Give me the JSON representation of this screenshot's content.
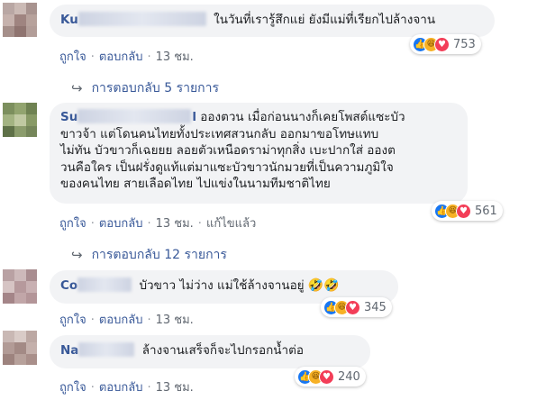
{
  "comments": [
    {
      "name": "Ku",
      "text": "ในวันที่เรารู้สึกแย่ ยังมีแม่ที่เรียกไปล้างจาน",
      "like": "ถูกใจ",
      "reply": "ตอบกลับ",
      "time": "13 ชม.",
      "reaction_count": "753",
      "reactions": [
        "like-icon",
        "haha-icon",
        "love-icon"
      ],
      "replies_label": "การตอบกลับ 5 รายการ"
    },
    {
      "name": "Su",
      "name_tail": "l",
      "text": "อองตวน เมื่อก่อนนางก็เคยโพสต์แซะบัวขาวจ้า แต่โดนคนไทยทั้งประเทศสวนกลับ ออกมาขอโทษแทบไม่ทัน บัวขาวก็เฉยยย ลอยตัวเหนือดราม่าทุกสิ่ง เบะปากใส่ อองตวนคือใคร เป็นฝรั่งดูแท้แต่มาแซะบัวขาวนักมวยที่เป็นความภูมิใจของคนไทย สายเลือดไทย ไปแข่งในนามทีมชาติไทย",
      "lines": [
        "อองตวน เมื่อก่อนนางก็เคยโพสต์แซะบัว",
        "ขาวจ้า แต่โดนคนไทยทั้งประเทศสวนกลับ ออกมาขอโทษแทบ",
        "ไม่ทัน บัวขาวก็เฉยยย ลอยตัวเหนือดราม่าทุกสิ่ง เบะปากใส่ อองต",
        "วนคือใคร เป็นฝรั่งดูแท้แต่มาแซะบัวขาวนักมวยที่เป็นความภูมิใจ",
        "ของคนไทย สายเลือดไทย ไปแข่งในนามทีมชาติไทย"
      ],
      "like": "ถูกใจ",
      "reply": "ตอบกลับ",
      "time": "13 ชม.",
      "edited": "แก้ไขแล้ว",
      "reaction_count": "561",
      "reactions": [
        "like-icon",
        "haha-icon",
        "love-icon"
      ],
      "replies_label": "การตอบกลับ 12 รายการ"
    },
    {
      "name": "Co",
      "text": "บัวขาว ไม่ว่าง แม่ใช้ล้างจานอยู่",
      "emoji": "🤣🤣",
      "like": "ถูกใจ",
      "reply": "ตอบกลับ",
      "time": "13 ชม.",
      "reaction_count": "345",
      "reactions": [
        "like-icon",
        "haha-icon",
        "love-icon"
      ]
    },
    {
      "name": "Na",
      "text": "ล้างจานเสร็จก็จะไปกรอกน้ำต่อ",
      "like": "ถูกใจ",
      "reply": "ตอบกลับ",
      "time": "13 ชม.",
      "reaction_count": "240",
      "reactions": [
        "like-icon",
        "haha-icon",
        "love-icon"
      ]
    }
  ],
  "separator": "·",
  "reply_arrow": "↪",
  "colors": {
    "link": "#385898",
    "bubble": "#f2f3f5",
    "like": "#1877f2",
    "haha": "#f7b125",
    "love": "#f33e58"
  }
}
